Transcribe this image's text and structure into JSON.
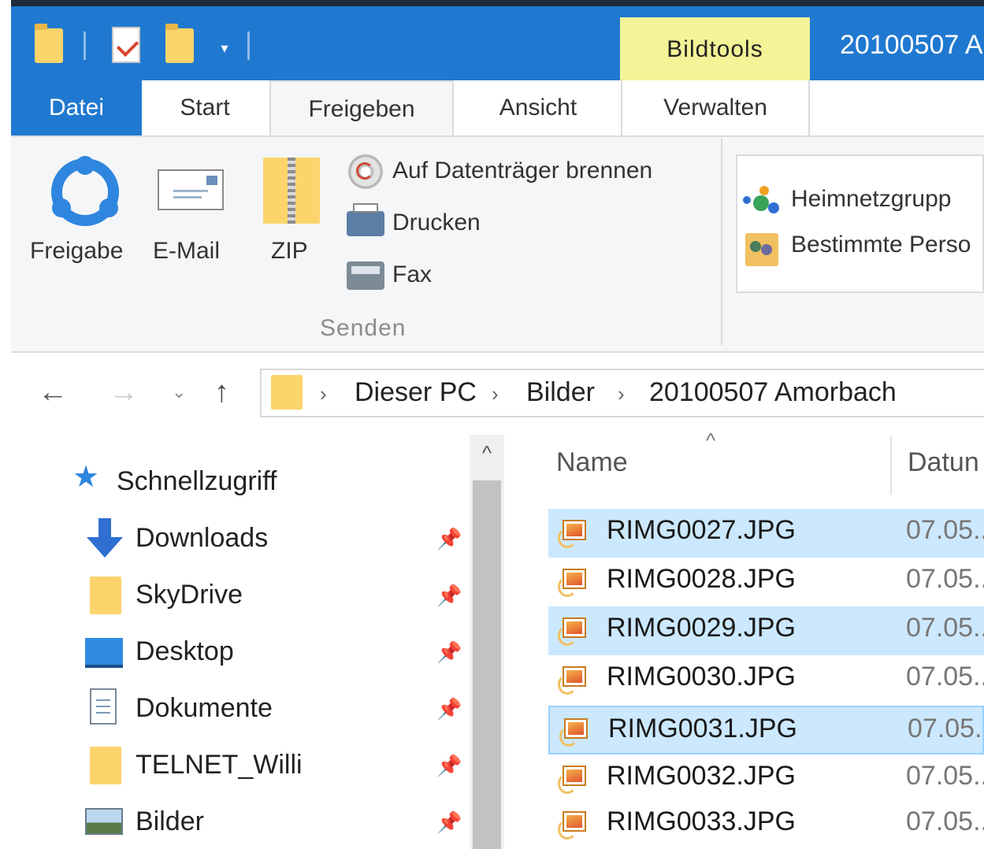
{
  "quick_access_toolbar": {
    "icons": [
      "folder-icon",
      "properties-icon",
      "new-folder-icon",
      "customize-dropdown-icon"
    ]
  },
  "context_tab": {
    "label": "Bildtools"
  },
  "window": {
    "title": "20100507 A"
  },
  "ribbon_tabs": {
    "datei": "Datei",
    "start": "Start",
    "freigeben": "Freigeben",
    "ansicht": "Ansicht",
    "verwalten": "Verwalten",
    "active": "Freigeben"
  },
  "ribbon": {
    "freigabe": "Freigabe",
    "email": "E-Mail",
    "zip": "ZIP",
    "burn": "Auf Datenträger brennen",
    "print": "Drucken",
    "fax": "Fax",
    "group_senden": "Senden",
    "homegroup": "Heimnetzgrupp",
    "specific_people": "Bestimmte Perso"
  },
  "address": {
    "back_icon": "←",
    "forward_icon": "→",
    "recent_icon": "⌄",
    "up_icon": "↑",
    "separator": "›",
    "breadcrumbs": [
      "Dieser PC",
      "Bilder",
      "20100507 Amorbach"
    ]
  },
  "navigation": {
    "quick_access": "Schnellzugriff",
    "pin_icon": "📌",
    "scroll_up_icon": "^",
    "items": [
      {
        "label": "Downloads",
        "icon": "downloads-icon",
        "pinned": true
      },
      {
        "label": "SkyDrive",
        "icon": "folder-icon",
        "pinned": true
      },
      {
        "label": "Desktop",
        "icon": "desktop-icon",
        "pinned": true
      },
      {
        "label": "Dokumente",
        "icon": "documents-icon",
        "pinned": true
      },
      {
        "label": "TELNET_Willi",
        "icon": "folder-icon",
        "pinned": true
      },
      {
        "label": "Bilder",
        "icon": "pictures-icon",
        "pinned": true
      }
    ]
  },
  "file_list": {
    "columns": {
      "name": "Name",
      "date": "Datun"
    },
    "sort_indicator": "^",
    "files": [
      {
        "name": "RIMG0027.JPG",
        "date": "07.05..",
        "selected": true
      },
      {
        "name": "RIMG0028.JPG",
        "date": "07.05..",
        "selected": false
      },
      {
        "name": "RIMG0029.JPG",
        "date": "07.05..",
        "selected": true
      },
      {
        "name": "RIMG0030.JPG",
        "date": "07.05..",
        "selected": false
      },
      {
        "name": "RIMG0031.JPG",
        "date": "07.05..",
        "selected": true
      },
      {
        "name": "RIMG0032.JPG",
        "date": "07.05..",
        "selected": false
      },
      {
        "name": "RIMG0033.JPG",
        "date": "07.05..",
        "selected": false
      }
    ]
  },
  "colors": {
    "accent": "#2079d0",
    "context_tab": "#f3f397",
    "selection": "#cce8ff",
    "folder": "#fbd46b"
  }
}
